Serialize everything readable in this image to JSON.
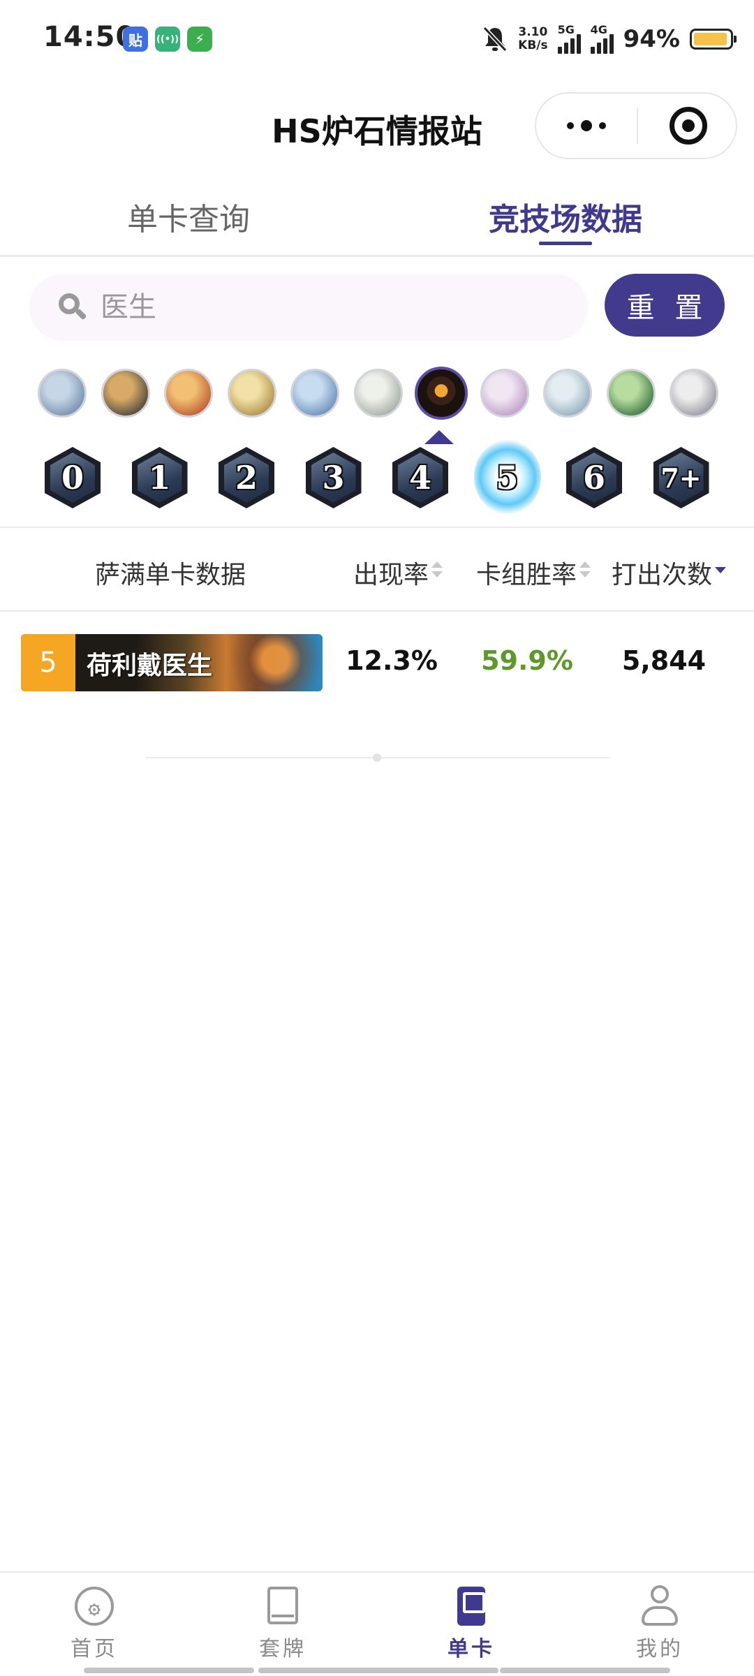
{
  "status_bar": {
    "time": "14:50",
    "app_icons": [
      "tieba-icon",
      "hotspot-icon",
      "charging-icon"
    ],
    "tieba_glyph": "贴",
    "hotspot_glyph": "((•))",
    "charge_glyph": "⚡",
    "net_speed_value": "3.10",
    "net_speed_unit": "KB/s",
    "signal_1": "5G",
    "signal_2": "4G",
    "battery": "94%",
    "battery_level": 0.94,
    "battery_color": "#f6c24a"
  },
  "header": {
    "title": "HS炉石情报站"
  },
  "tabs": [
    {
      "label": "单卡查询",
      "active": false
    },
    {
      "label": "竞技场数据",
      "active": true
    }
  ],
  "search": {
    "value": "",
    "placeholder": "医生",
    "reset_label": "重 置"
  },
  "class_filter": {
    "selected": "shaman",
    "classes": [
      {
        "name": "death-knight",
        "colors": [
          "#c7d6e6",
          "#6b86a8"
        ]
      },
      {
        "name": "demon-hunter",
        "colors": [
          "#d7aa68",
          "#3c3a38"
        ]
      },
      {
        "name": "druid",
        "colors": [
          "#f2c074",
          "#b7502a"
        ]
      },
      {
        "name": "hunter",
        "colors": [
          "#f1e1a8",
          "#a9853c"
        ]
      },
      {
        "name": "mage",
        "colors": [
          "#c7dcef",
          "#5f87b5"
        ]
      },
      {
        "name": "paladin",
        "colors": [
          "#eef0ea",
          "#9aa79b"
        ]
      },
      {
        "name": "shaman",
        "colors": [
          "#f2a733",
          "#1b120e"
        ]
      },
      {
        "name": "priest",
        "colors": [
          "#f1e7f3",
          "#b893c4"
        ]
      },
      {
        "name": "rogue",
        "colors": [
          "#e4edf2",
          "#8aa6b8"
        ]
      },
      {
        "name": "warlock",
        "colors": [
          "#b7dca0",
          "#2f6b38"
        ]
      },
      {
        "name": "warrior",
        "colors": [
          "#ededed",
          "#8d8d99"
        ]
      }
    ]
  },
  "cost_filter": {
    "options": [
      "0",
      "1",
      "2",
      "3",
      "4",
      "5",
      "6",
      "7+"
    ],
    "selected": "5",
    "glow_color": "#5fc9f5"
  },
  "table": {
    "headers": {
      "name": "萨满单卡数据",
      "rate": "出现率",
      "win": "卡组胜率",
      "plays": "打出次数"
    },
    "sort_active": "plays",
    "rows": [
      {
        "cost": "5",
        "name": "荷利戴医生",
        "rate": "12.3%",
        "win": "59.9%",
        "plays": "5,844"
      }
    ],
    "cost_badge_color": "#f5a623",
    "win_color": "#5b9a28"
  },
  "bottom_nav": [
    {
      "label": "首页",
      "icon": "hearthstone-logo-icon",
      "glyph": "۞",
      "active": false
    },
    {
      "label": "套牌",
      "icon": "deck-book-icon",
      "active": false
    },
    {
      "label": "单卡",
      "icon": "card-icon",
      "active": true
    },
    {
      "label": "我的",
      "icon": "profile-icon",
      "active": false
    }
  ],
  "theme": {
    "accent": "#3f3a8f"
  }
}
